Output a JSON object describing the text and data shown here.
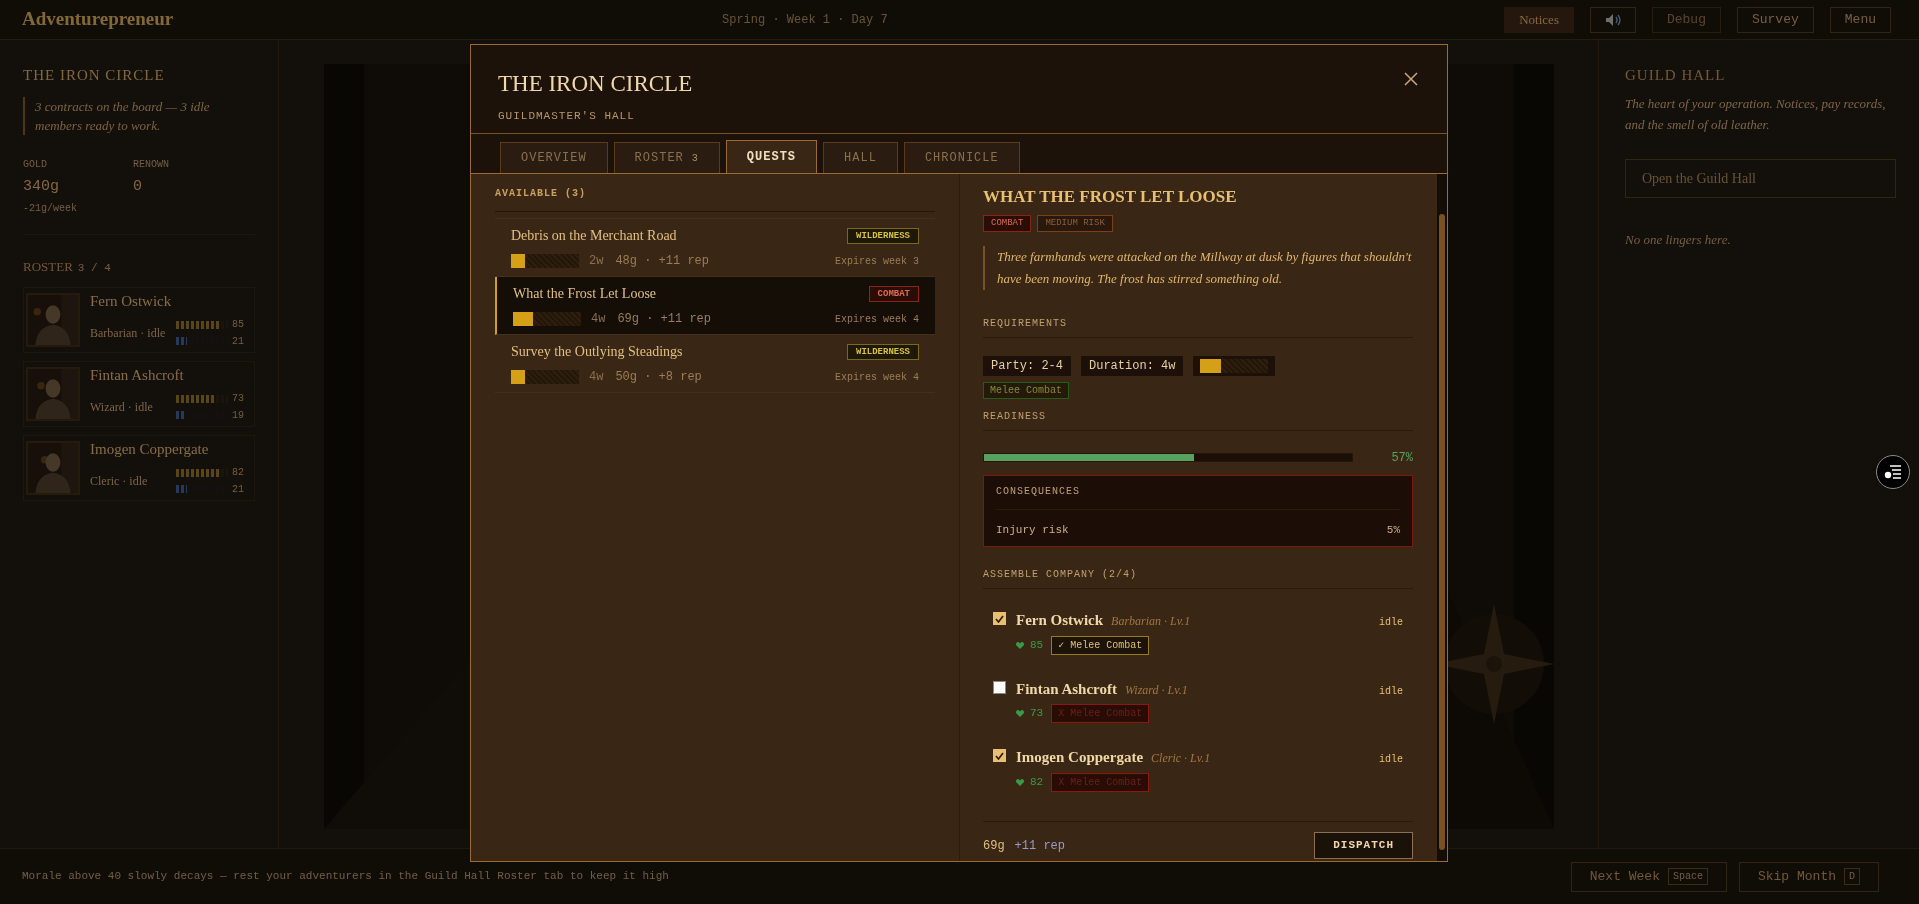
{
  "topbar": {
    "title": "Adventurepreneur",
    "date": "Spring · Week 1 · Day 7",
    "buttons": [
      {
        "kind": "text",
        "label": "Notices",
        "active": true,
        "disabled": false
      },
      {
        "kind": "sound",
        "active": false,
        "disabled": false
      },
      {
        "kind": "text",
        "label": "Debug",
        "active": false,
        "disabled": true
      },
      {
        "kind": "text",
        "label": "Survey",
        "active": false,
        "disabled": false
      },
      {
        "kind": "text",
        "label": "Menu",
        "active": false,
        "disabled": false
      }
    ]
  },
  "guild": {
    "name": "THE IRON CIRCLE",
    "summary": "3 contracts on the board — 3 idle members ready to work.",
    "stats": [
      {
        "label": "GOLD",
        "value": "340g",
        "note": "-21g/week"
      },
      {
        "label": "RENOWN",
        "value": "0"
      }
    ],
    "roster_title": "ROSTER",
    "roster_count": "3 / 4",
    "members": [
      {
        "name": "Fern Ostwick",
        "role": "Barbarian · idle",
        "health": {
          "level": 0.85,
          "reading": "85"
        },
        "morale": {
          "level": 0.21,
          "reading": "21"
        }
      },
      {
        "name": "Fintan Ashcroft",
        "role": "Wizard · idle",
        "health": {
          "level": 0.73,
          "reading": "73"
        },
        "morale": {
          "level": 0.19,
          "reading": "19"
        }
      },
      {
        "name": "Imogen Coppergate",
        "role": "Cleric · idle",
        "health": {
          "level": 0.82,
          "reading": "82"
        },
        "morale": {
          "level": 0.21,
          "reading": "21"
        }
      }
    ]
  },
  "modal": {
    "title": "THE IRON CIRCLE",
    "subtitle": "GUILDMASTER'S HALL",
    "tabs": [
      {
        "label": "OVERVIEW",
        "selected": false
      },
      {
        "label": "ROSTER",
        "badge": "3",
        "selected": false
      },
      {
        "label": "QUESTS",
        "selected": true
      },
      {
        "label": "HALL",
        "selected": false
      },
      {
        "label": "CHRONICLE",
        "selected": false
      }
    ],
    "quest_heading": "AVAILABLE (3)",
    "quests": [
      {
        "title": "Debris on the Merchant Road",
        "tag": {
          "kind": "wilderness",
          "label": "WILDERNESS"
        },
        "difficulty": {
          "level": 0.2
        },
        "duration": "2w",
        "reward": "48g · +11 rep",
        "expires": "Expires week 3",
        "selected": false
      },
      {
        "title": "What the Frost Let Loose",
        "tag": {
          "kind": "combat",
          "label": "COMBAT"
        },
        "difficulty": {
          "level": 0.3
        },
        "duration": "4w",
        "reward": "69g · +11 rep",
        "expires": "Expires week 4",
        "selected": true
      },
      {
        "title": "Survey the Outlying Steadings",
        "tag": {
          "kind": "wilderness",
          "label": "WILDERNESS"
        },
        "difficulty": {
          "level": 0.2
        },
        "duration": "4w",
        "reward": "50g · +8 rep",
        "expires": "Expires week 4",
        "selected": false
      }
    ],
    "detail": {
      "title": "WHAT THE FROST LET LOOSE",
      "tags": [
        {
          "kind": "combat",
          "label": "COMBAT"
        },
        {
          "kind": "risk",
          "label": "MEDIUM RISK"
        }
      ],
      "description": "Three farmhands were attacked on the Millway at dusk by figures that shouldn't have been moving. The frost has stirred something old.",
      "requirements_heading": "REQUIREMENTS",
      "chips": [
        "Party: 2-4",
        "Duration: 4w"
      ],
      "difficulty": {
        "level": 0.3
      },
      "skill": "Melee Combat",
      "readiness_heading": "READINESS",
      "readiness": {
        "level": 0.57,
        "reading": "57%"
      },
      "consequences": {
        "heading": "CONSEQUENCES",
        "rows": [
          {
            "label": "Injury risk",
            "value": "5%"
          }
        ]
      },
      "company_heading": "ASSEMBLE COMPANY (2/4)",
      "company": [
        {
          "name": "Fern Ostwick",
          "role": "Barbarian · Lv.1",
          "status": "idle",
          "checked": true,
          "health": "85",
          "skill": {
            "mark": "✓",
            "label": "Melee Combat",
            "met": true
          }
        },
        {
          "name": "Fintan Ashcroft",
          "role": "Wizard · Lv.1",
          "status": "idle",
          "checked": false,
          "health": "73",
          "skill": {
            "mark": "X",
            "label": "Melee Combat",
            "met": false
          }
        },
        {
          "name": "Imogen Coppergate",
          "role": "Cleric · Lv.1",
          "status": "idle",
          "checked": true,
          "health": "82",
          "skill": {
            "mark": "X",
            "label": "Melee Combat",
            "met": false
          }
        }
      ],
      "reward_gold": "69g",
      "reward_rep": "+11 rep",
      "dispatch": "DISPATCH"
    }
  },
  "hall": {
    "title": "GUILD HALL",
    "description": "The heart of your operation. Notices, pay records, and the smell of old leather.",
    "button": "Open the Guild Hall",
    "empty": "No one lingers here."
  },
  "bottom": {
    "hint": "Morale above 40 slowly decays — rest your adventurers in the Guild Hall Roster tab to keep it high",
    "buttons": [
      {
        "label": "Next Week",
        "key": "Space"
      },
      {
        "label": "Skip Month",
        "key": "D"
      }
    ]
  }
}
